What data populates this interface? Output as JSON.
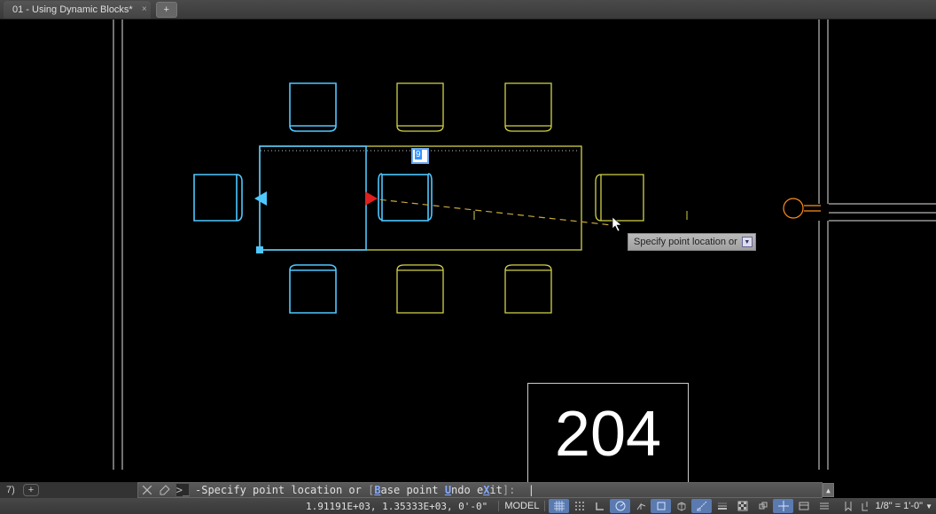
{
  "tabs": {
    "active_label": "01 - Using Dynamic Blocks*",
    "add_label": "+"
  },
  "canvas": {
    "room_number": "204",
    "dyn_input_value": "9"
  },
  "tooltip": {
    "text": "Specify point location or"
  },
  "command_line": {
    "prefix": "-",
    "text_plain": "Specify point location or ",
    "bracket_open": "[",
    "option1_hot": "B",
    "option1_rest": "ase point",
    "sep1": " ",
    "option2_hot": "U",
    "option2_rest": "ndo",
    "sep2": " e",
    "option3_hot": "X",
    "option3_rest": "it",
    "bracket_close": "]:"
  },
  "layout_tabs": {
    "item1": "7)",
    "add": "+"
  },
  "status": {
    "coords": "1.91191E+03, 1.35333E+03, 0'-0\"",
    "model": "MODEL",
    "scale_label": "1/8\" = 1'-0\""
  }
}
